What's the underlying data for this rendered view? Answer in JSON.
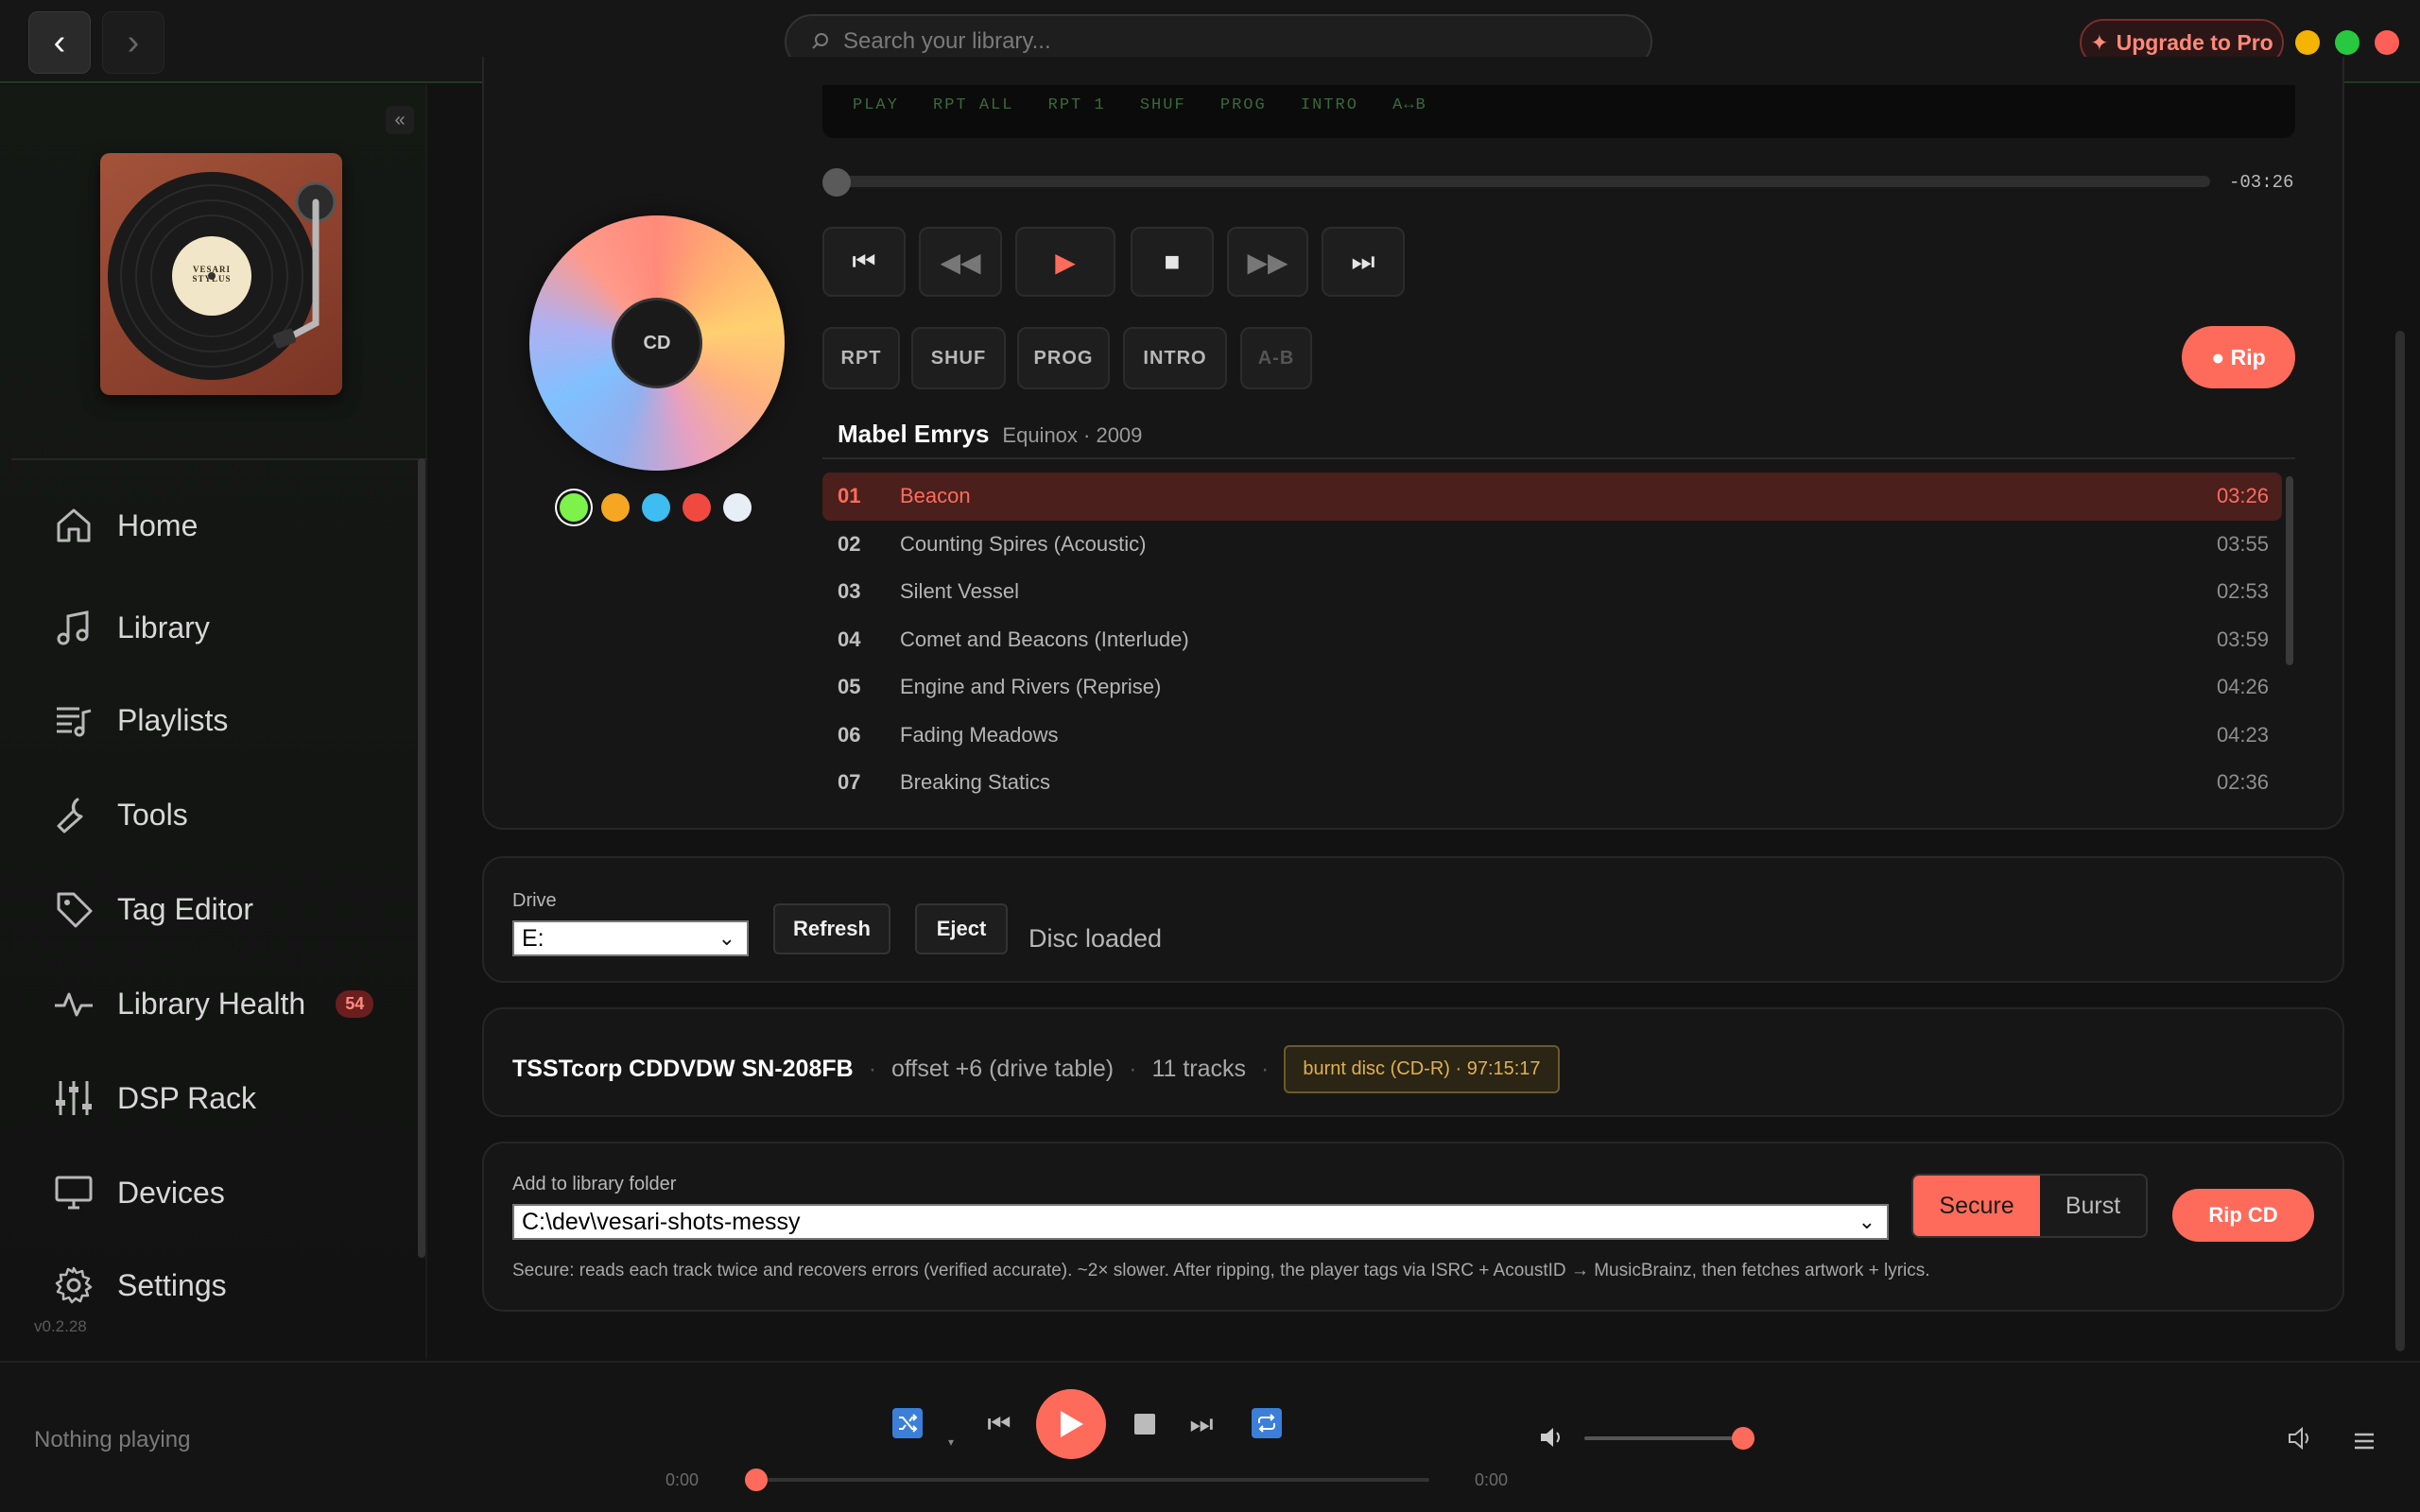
{
  "header": {
    "search_placeholder": "Search your library...",
    "upgrade_label": "Upgrade to Pro"
  },
  "sidebar": {
    "items": [
      {
        "label": "Home"
      },
      {
        "label": "Library"
      },
      {
        "label": "Playlists"
      },
      {
        "label": "Tools"
      },
      {
        "label": "Tag Editor"
      },
      {
        "label": "Library Health",
        "badge": "54"
      },
      {
        "label": "DSP Rack"
      },
      {
        "label": "Devices"
      },
      {
        "label": "Settings"
      }
    ],
    "version": "v0.2.28",
    "logo_text": "VESARI STYLUS"
  },
  "player": {
    "lcd_modes": [
      "PLAY",
      "RPT ALL",
      "RPT 1",
      "SHUF",
      "PROG",
      "INTRO",
      "A↔B"
    ],
    "remaining": "-03:26",
    "disc_label": "CD",
    "mode_buttons": [
      "RPT",
      "SHUF",
      "PROG",
      "INTRO",
      "A-B"
    ],
    "rip_label": "● Rip",
    "artist": "Mabel Emrys",
    "album_meta": "Equinox · 2009",
    "swatches": [
      "#7CF24A",
      "#F5A623",
      "#3DBDF0",
      "#F04A40",
      "#E8EEF5"
    ],
    "tracks": [
      {
        "num": "01",
        "title": "Beacon",
        "dur": "03:26"
      },
      {
        "num": "02",
        "title": "Counting Spires (Acoustic)",
        "dur": "03:55"
      },
      {
        "num": "03",
        "title": "Silent Vessel",
        "dur": "02:53"
      },
      {
        "num": "04",
        "title": "Comet and Beacons (Interlude)",
        "dur": "03:59"
      },
      {
        "num": "05",
        "title": "Engine and Rivers (Reprise)",
        "dur": "04:26"
      },
      {
        "num": "06",
        "title": "Fading Meadows",
        "dur": "04:23"
      },
      {
        "num": "07",
        "title": "Breaking Statics",
        "dur": "02:36"
      }
    ]
  },
  "drive": {
    "label": "Drive",
    "selected": "E:",
    "refresh_label": "Refresh",
    "eject_label": "Eject",
    "status": "Disc loaded"
  },
  "info": {
    "drive_name": "TSSTcorp CDDVDW SN-208FB",
    "offset": "offset +6 (drive table)",
    "tracks": "11 tracks",
    "disc_type": "burnt disc (CD-R) · 97:15:17"
  },
  "rip": {
    "folder_label": "Add to library folder",
    "folder_value": "C:\\dev\\vesari-shots-messy",
    "mode_secure": "Secure",
    "mode_burst": "Burst",
    "rip_cd_label": "Rip CD",
    "help": "Secure: reads each track twice and recovers errors (verified accurate). ~2× slower. After ripping, the player tags via ISRC + AcoustID → MusicBrainz, then fetches artwork + lyrics."
  },
  "bottom": {
    "now_playing": "Nothing playing",
    "time_current": "0:00",
    "time_total": "0:00",
    "volume": 0.92
  },
  "colors": {
    "accent": "#FF6B5B",
    "bg": "#121212",
    "card": "#161616"
  }
}
